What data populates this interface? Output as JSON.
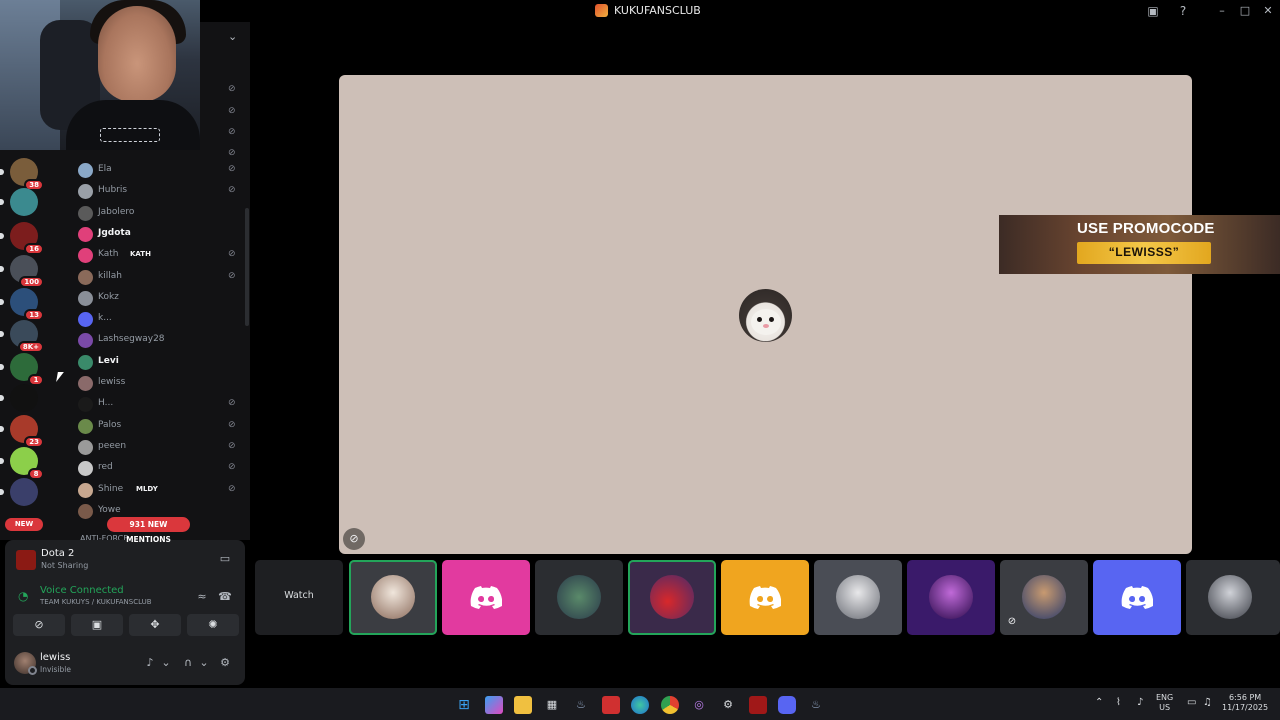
{
  "window": {
    "title": "KUKUFANSCLUB"
  },
  "servers": [
    {
      "name": "server-1",
      "badge": "38",
      "color": "#7a5d3b"
    },
    {
      "name": "server-2",
      "badge": "",
      "color": "#3b8a8f"
    },
    {
      "name": "server-3",
      "badge": "16",
      "color": "#7c1d1d"
    },
    {
      "name": "server-4",
      "badge": "100",
      "color": "#4a4f58"
    },
    {
      "name": "server-5",
      "badge": "13",
      "color": "#2c4f7a"
    },
    {
      "name": "server-6",
      "badge": "8K+",
      "color": "#3a4a5a"
    },
    {
      "name": "server-7",
      "badge": "1",
      "color": "#2d6b3a"
    },
    {
      "name": "server-8",
      "badge": "",
      "color": "#111111"
    },
    {
      "name": "server-9",
      "badge": "23",
      "color": "#a83a2a"
    },
    {
      "name": "server-10",
      "badge": "8",
      "color": "#8ccf4a"
    },
    {
      "name": "server-11",
      "badge": "",
      "color": "#3a3f6a"
    }
  ],
  "new_pill": "NEW",
  "members": [
    {
      "name": "Ela",
      "bright": false,
      "muted": true,
      "color": "#8aa8c8"
    },
    {
      "name": "Hubris",
      "bright": false,
      "muted": true,
      "color": "#9aa0a8"
    },
    {
      "name": "Jabolero",
      "bright": false,
      "muted": false,
      "color": "#5a5a5a"
    },
    {
      "name": "Jgdota",
      "bright": true,
      "muted": false,
      "color": "#e0407a"
    },
    {
      "name": "Kath",
      "bright": false,
      "muted": true,
      "color": "#e0407a",
      "tag": "KATH"
    },
    {
      "name": "killah",
      "bright": false,
      "muted": true,
      "color": "#8a6a5a"
    },
    {
      "name": "Kokz",
      "bright": false,
      "muted": false,
      "color": "#8a8f98"
    },
    {
      "name": "k...",
      "bright": false,
      "muted": false,
      "color": "#5865f2"
    },
    {
      "name": "Lashsegway28",
      "bright": false,
      "muted": false,
      "color": "#7a4aa8"
    },
    {
      "name": "Levi",
      "bright": true,
      "muted": false,
      "color": "#3a8a6a"
    },
    {
      "name": "lewiss",
      "bright": false,
      "muted": false,
      "color": "#8a6a6a"
    },
    {
      "name": "H...",
      "bright": false,
      "muted": true,
      "color": "#1a1a1a"
    },
    {
      "name": "Palos",
      "bright": false,
      "muted": true,
      "color": "#6a8a4a"
    },
    {
      "name": "peeen",
      "bright": false,
      "muted": true,
      "color": "#9a9a9a"
    },
    {
      "name": "red",
      "bright": false,
      "muted": true,
      "color": "#c8c8c8"
    },
    {
      "name": "Shine",
      "bright": false,
      "muted": true,
      "color": "#c8a890",
      "tag": "MLDY"
    },
    {
      "name": "Yowe",
      "bright": false,
      "muted": false,
      "color": "#7a5a4a"
    }
  ],
  "mentions_pill": "931 NEW MENTIONS",
  "partial_channel": "ANTI-FORCE",
  "activity": {
    "game": "Dota 2",
    "status": "Not Sharing"
  },
  "voice": {
    "status": "Voice Connected",
    "channel": "TEAM KUKUYS / KUKUFANSCLUB"
  },
  "user": {
    "name": "lewiss",
    "status": "Invisible"
  },
  "promo": {
    "line1": "USE PROMOCODE",
    "line2": "“LEWISSS”"
  },
  "tiles": {
    "watch_label": "Watch"
  },
  "tray": {
    "lang": "ENG",
    "region": "US",
    "time": "6:56 PM",
    "date": "11/17/2025"
  }
}
